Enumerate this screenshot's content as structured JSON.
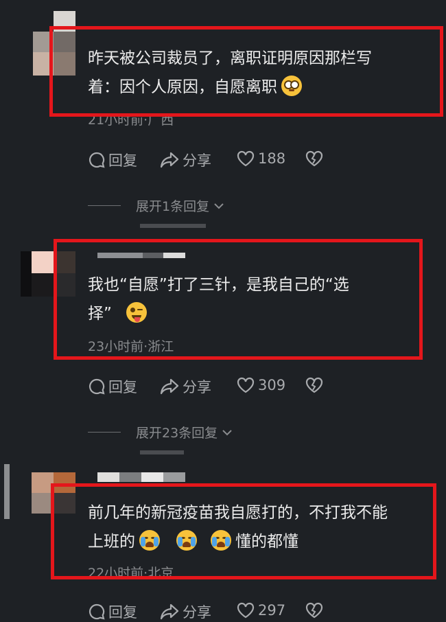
{
  "comments": [
    {
      "text_line1": "昨天被公司裁员了，离职证明原因那栏写",
      "text_line2": "着：因个人原因，自愿离职",
      "emoji_icon": "pleading-face-icon",
      "time_location": "21小时前·广西",
      "reply_label": "回复",
      "share_label": "分享",
      "likes": "188",
      "expand_label": "展开1条回复"
    },
    {
      "text_line1": "我也“自愿”打了三针，是我自己的“选",
      "text_line2": "择”",
      "emoji_icon": "winking-tongue-face-icon",
      "time_location": "23小时前·浙江",
      "reply_label": "回复",
      "share_label": "分享",
      "likes": "309",
      "expand_label": "展开23条回复"
    },
    {
      "text_line1": "前几年的新冠疫苗我自愿打的，不打我不能",
      "text_line2_prefix": "上班的",
      "text_line2_suffix": "懂的都懂",
      "emoji_icon": "crying-face-icon",
      "time_location": "22小时前·北京",
      "reply_label": "回复",
      "share_label": "分享",
      "likes": "297"
    }
  ],
  "colors": {
    "highlight_box": "#e4161b",
    "background": "#1e2125",
    "emoji": "#f7c23b"
  }
}
